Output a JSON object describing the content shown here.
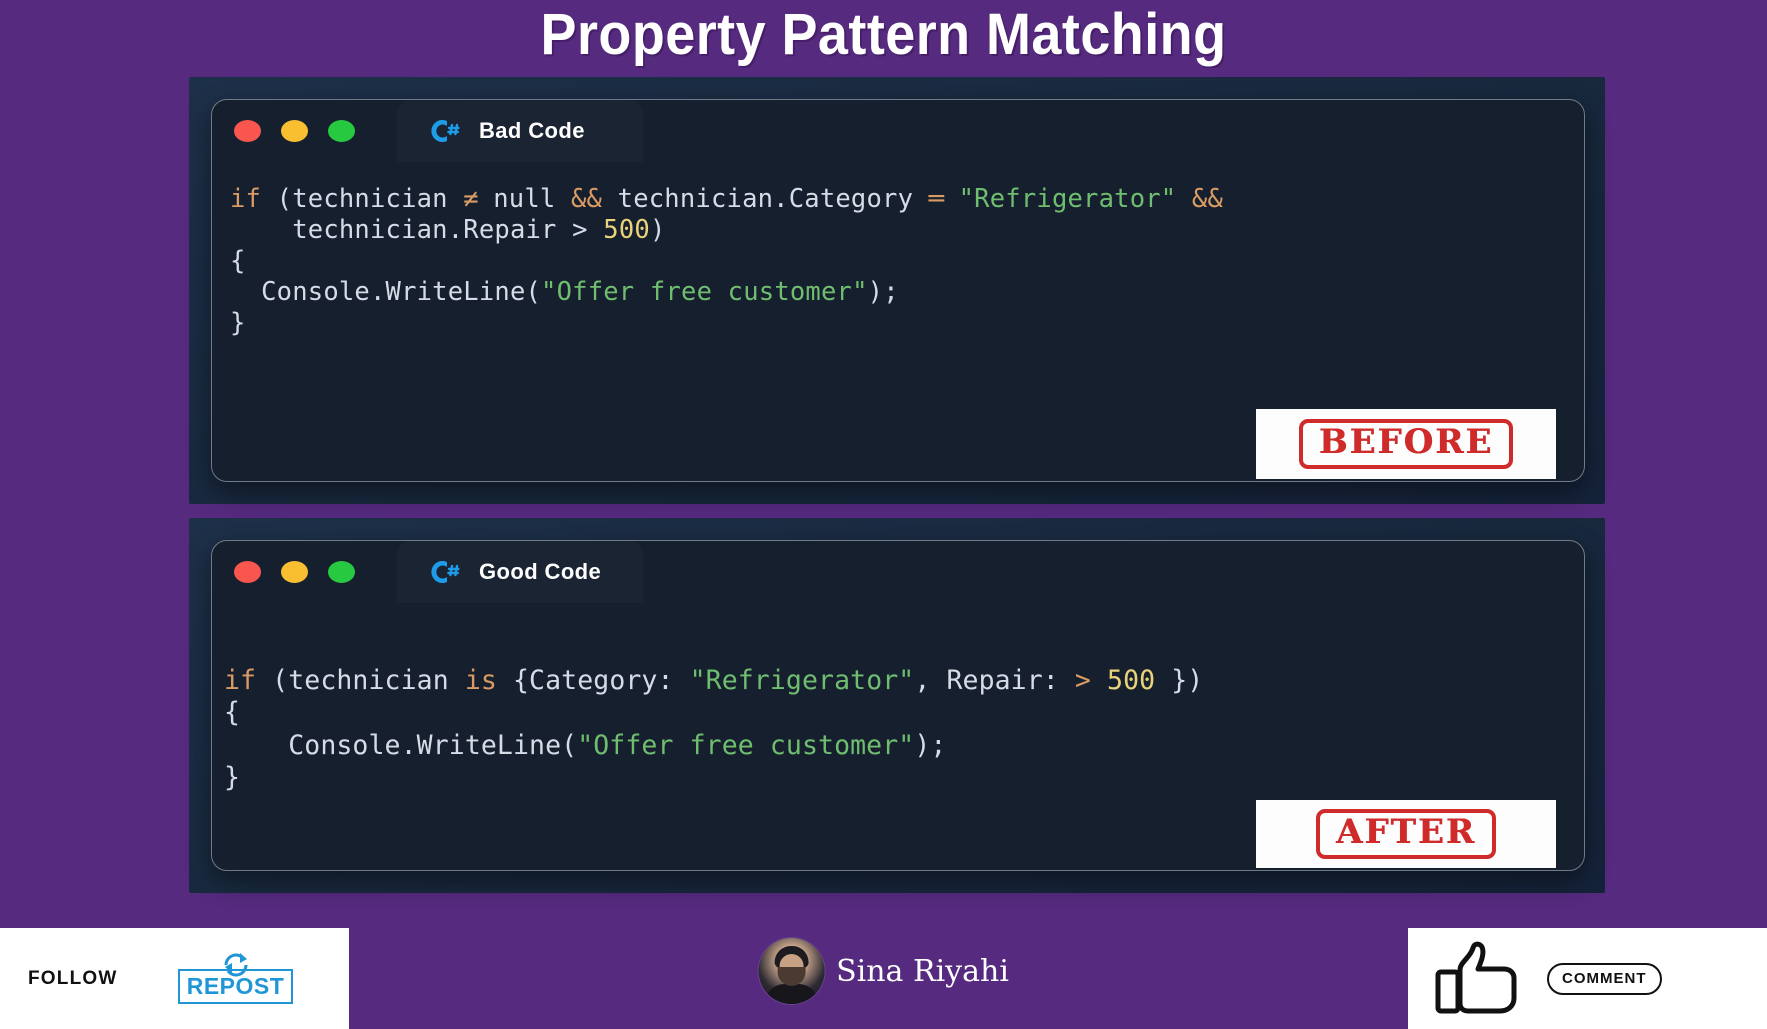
{
  "title": "Property Pattern Matching",
  "theme": {
    "background": "#552a7f",
    "panel_frame": "#1d3049",
    "window_bg": "#161f2e",
    "accent_red": "#d02b2b",
    "accent_blue": "#2196d6",
    "string_green": "#6fbd6f",
    "keyword_orange": "#d99a63",
    "number_yellow": "#e8d37a"
  },
  "panels": [
    {
      "id": "before",
      "tab_label": "Bad Code",
      "tab_icon": "csharp-icon",
      "traffic_lights": [
        "close-red",
        "minimize-yellow",
        "maximize-green"
      ],
      "stamp": "BEFORE",
      "code_lines": [
        [
          {
            "t": "if",
            "c": "k"
          },
          {
            "t": " (technician ",
            "c": "p"
          },
          {
            "t": "≠",
            "c": "lig"
          },
          {
            "t": " null ",
            "c": "p"
          },
          {
            "t": "&&",
            "c": "k"
          },
          {
            "t": " technician.Category ",
            "c": "p"
          },
          {
            "t": "═",
            "c": "lig"
          },
          {
            "t": " ",
            "c": "p"
          },
          {
            "t": "\"Refrigerator\"",
            "c": "s"
          },
          {
            "t": " ",
            "c": "p"
          },
          {
            "t": "&&",
            "c": "k"
          }
        ],
        [
          {
            "t": "    technician.Repair ",
            "c": "p"
          },
          {
            "t": ">",
            "c": "p"
          },
          {
            "t": " ",
            "c": "p"
          },
          {
            "t": "500",
            "c": "n"
          },
          {
            "t": ")",
            "c": "p"
          }
        ],
        [
          {
            "t": "{",
            "c": "p"
          }
        ],
        [
          {
            "t": "  Console.WriteLine(",
            "c": "p"
          },
          {
            "t": "\"Offer free customer\"",
            "c": "s"
          },
          {
            "t": ");",
            "c": "p"
          }
        ],
        [
          {
            "t": "}",
            "c": "p"
          }
        ]
      ],
      "code_plain": "if (technician != null && technician.Category == \"Refrigerator\" &&\n    technician.Repair > 500)\n{\n  Console.WriteLine(\"Offer free customer\");\n}"
    },
    {
      "id": "after",
      "tab_label": "Good Code",
      "tab_icon": "csharp-icon",
      "traffic_lights": [
        "close-red",
        "minimize-yellow",
        "maximize-green"
      ],
      "stamp": "AFTER",
      "code_lines": [
        [
          {
            "t": "if",
            "c": "k"
          },
          {
            "t": " (technician ",
            "c": "p"
          },
          {
            "t": "is",
            "c": "k"
          },
          {
            "t": " {Category: ",
            "c": "p"
          },
          {
            "t": "\"Refrigerator\"",
            "c": "s"
          },
          {
            "t": ", Repair: ",
            "c": "p"
          },
          {
            "t": ">",
            "c": "k"
          },
          {
            "t": " ",
            "c": "p"
          },
          {
            "t": "500",
            "c": "n"
          },
          {
            "t": " })",
            "c": "p"
          }
        ],
        [
          {
            "t": "{",
            "c": "p"
          }
        ],
        [
          {
            "t": "    Console.WriteLine(",
            "c": "p"
          },
          {
            "t": "\"Offer free customer\"",
            "c": "s"
          },
          {
            "t": ");",
            "c": "p"
          }
        ],
        [
          {
            "t": "}",
            "c": "p"
          }
        ]
      ],
      "code_plain": "if (technician is {Category: \"Refrigerator\", Repair: > 500 })\n{\n    Console.WriteLine(\"Offer free customer\");\n}"
    }
  ],
  "footer": {
    "follow_label": "FOLLOW",
    "repost_label": "REPOST",
    "author_name": "Sina Riyahi",
    "comment_label": "COMMENT",
    "like_icon": "thumbs-up-icon",
    "repost_icon": "repost-arrows-icon",
    "avatar_icon": "avatar"
  }
}
